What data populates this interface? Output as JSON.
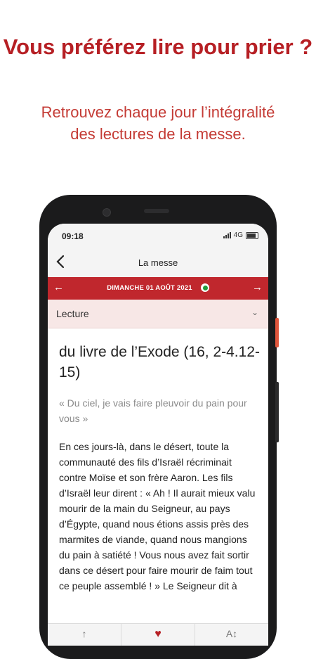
{
  "promo": {
    "headline": "Vous préférez lire pour prier ?",
    "subline": "Retrouvez chaque jour l’intégralité des lectures de la messe."
  },
  "status_bar": {
    "time": "09:18",
    "network": "4G"
  },
  "app_bar": {
    "title": "La messe"
  },
  "date_bar": {
    "date": "DIMANCHE 01 AOÛT 2021",
    "liturgical_color": "#1f9a3a"
  },
  "selector": {
    "value": "Lecture"
  },
  "reading": {
    "title": "du livre de l’Exode (16, 2-4.12-15)",
    "quote": "« Du ciel, je vais faire pleuvoir du pain pour vous »",
    "body": "En ces jours-là, dans le désert, toute la communauté des fils d’Israël récriminait contre Moïse et son frère Aaron. Les fils d’Israël leur dirent : « Ah ! Il aurait mieux valu mourir de la main du Seigneur, au pays d’Égypte, quand nous étions assis près des marmites de viande, quand nous mangions du pain à satiété ! Vous nous avez fait sortir dans ce désert pour faire mourir de faim tout ce peuple assemblé ! » Le Seigneur dit à"
  },
  "bottom_nav": {
    "share_icon": "share-icon",
    "favorite_icon": "heart-icon",
    "text_size_icon": "text-size-icon"
  },
  "colors": {
    "brand_red": "#b61f24",
    "bar_red": "#c0272d"
  }
}
